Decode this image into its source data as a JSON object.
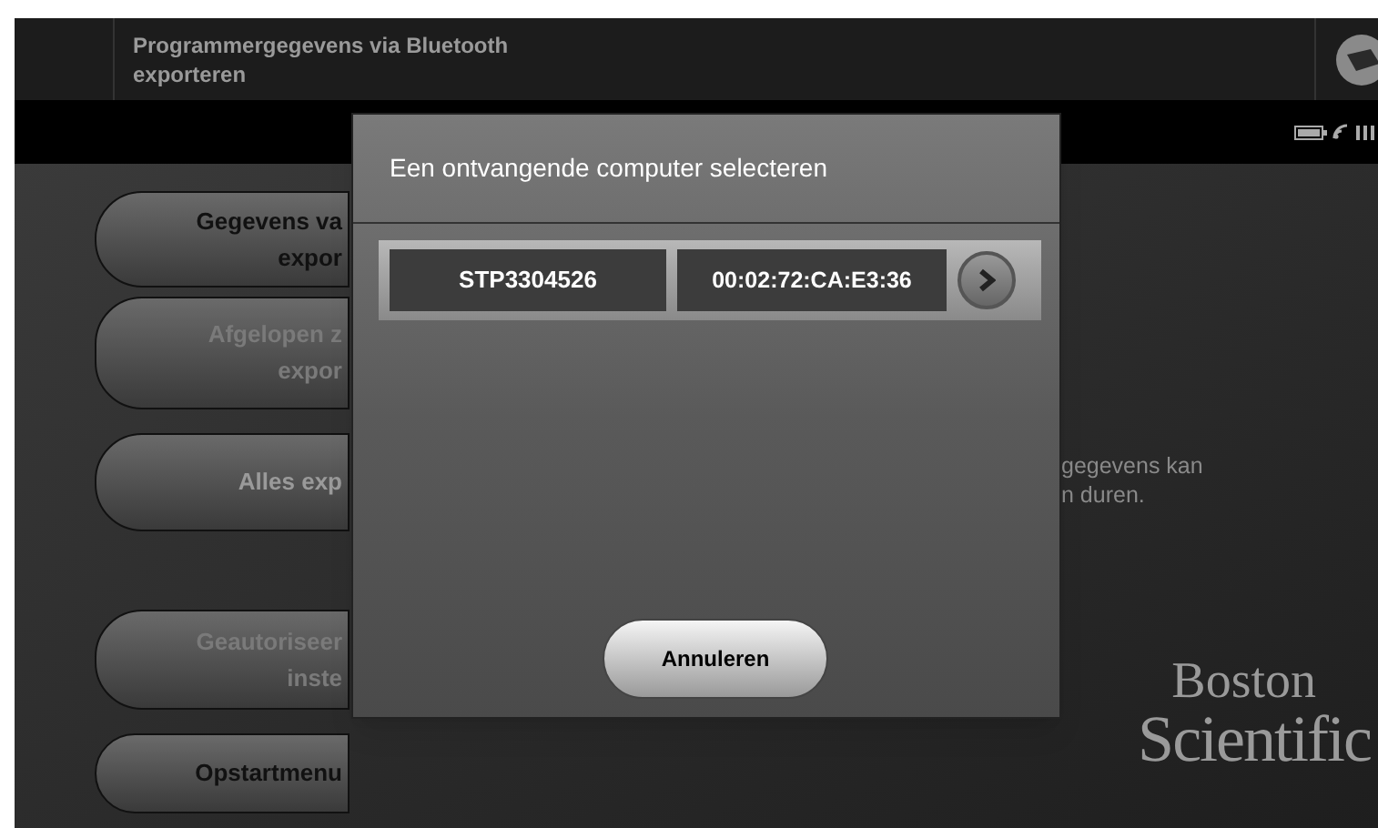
{
  "header": {
    "title": "Programmergegevens via Bluetooth exporteren"
  },
  "menu_buttons": [
    {
      "lines": [
        "Gegevens va",
        "expor"
      ],
      "disabled": false
    },
    {
      "lines": [
        "Afgelopen z",
        "expor"
      ],
      "disabled": true
    },
    {
      "lines": [
        "Alles exp"
      ],
      "disabled": true
    },
    {
      "lines": [
        "Geautoriseer",
        "inste"
      ],
      "disabled": true
    },
    {
      "lines": [
        "Opstartmenu"
      ],
      "disabled": false
    }
  ],
  "notice": {
    "lines": [
      "gegevens kan",
      "n duren."
    ]
  },
  "logo": {
    "lines": [
      "Boston",
      "Scientific"
    ]
  },
  "dialog": {
    "title": "Een ontvangende computer selecteren",
    "devices": [
      {
        "name": "STP3304526",
        "address": "00:02:72:CA:E3:36"
      }
    ],
    "cancel": "Annuleren"
  }
}
